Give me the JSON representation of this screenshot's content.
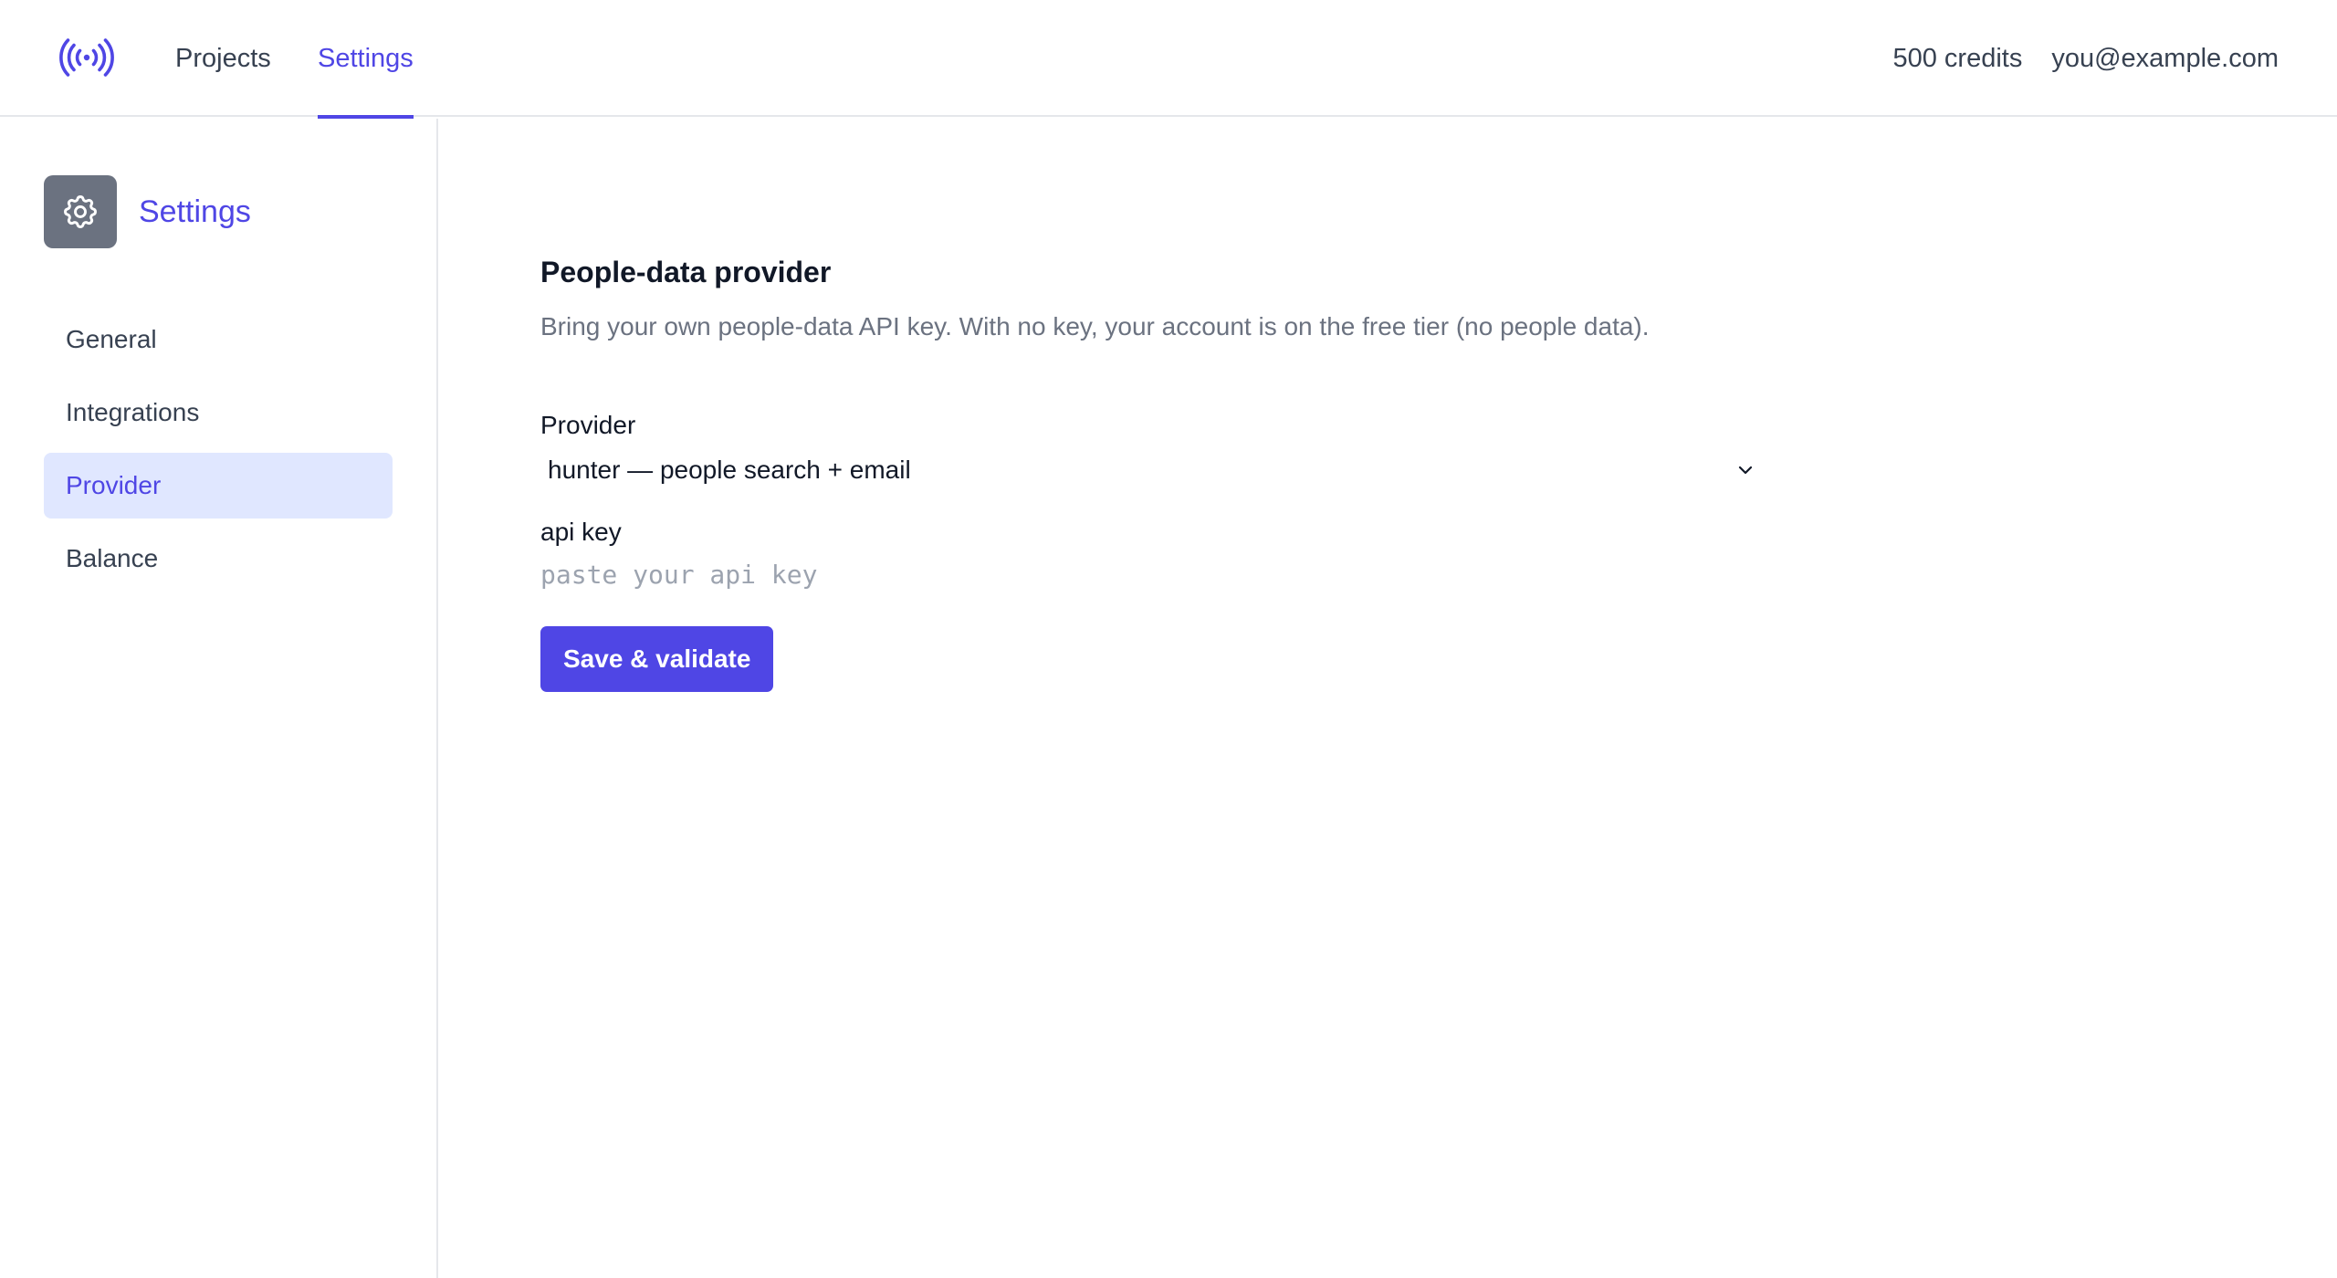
{
  "topbar": {
    "logo_icon": "broadcast-signal-icon",
    "nav": {
      "projects": "Projects",
      "settings": "Settings"
    },
    "active_tab": "Settings",
    "credits": "500 credits",
    "user_email": "you@example.com"
  },
  "sidebar": {
    "header_icon": "gear-icon",
    "title": "Settings",
    "items": [
      {
        "label": "General",
        "active": false
      },
      {
        "label": "Integrations",
        "active": false
      },
      {
        "label": "Provider",
        "active": true
      },
      {
        "label": "Balance",
        "active": false
      }
    ]
  },
  "main": {
    "section_title": "People-data provider",
    "section_description": "Bring your own people-data API key. With no key, your account is on the free tier (no people data).",
    "provider_field": {
      "label": "Provider",
      "selected_value": "hunter — people search + email"
    },
    "api_key_field": {
      "label": "api key",
      "value": "",
      "placeholder": "paste your api key"
    },
    "save_button_label": "Save & validate"
  },
  "colors": {
    "accent": "#4f46e5",
    "accent_light": "#e0e7ff",
    "text_primary": "#111827",
    "text_secondary": "#374151",
    "text_muted": "#6b7280",
    "placeholder": "#9ca3af",
    "border": "#e5e7eb",
    "gear_box": "#6b7280"
  }
}
